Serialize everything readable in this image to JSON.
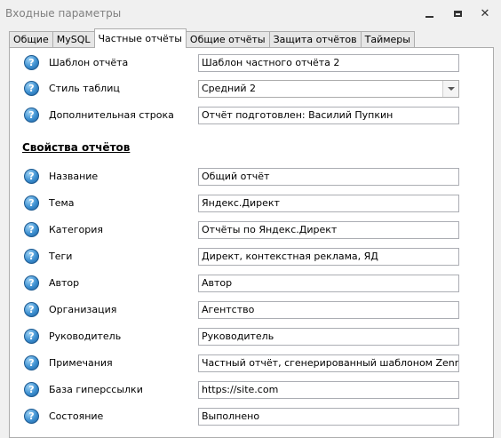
{
  "window": {
    "title": "Входные параметры",
    "controls": {
      "minimize": "minimize-icon",
      "maximize": "restore-icon",
      "close": "close-icon"
    }
  },
  "tabs": [
    {
      "label": "Общие",
      "active": false
    },
    {
      "label": "MySQL",
      "active": false
    },
    {
      "label": "Частные отчёты",
      "active": true
    },
    {
      "label": "Общие отчёты",
      "active": false
    },
    {
      "label": "Защита отчётов",
      "active": false
    },
    {
      "label": "Таймеры",
      "active": false
    }
  ],
  "report_settings": [
    {
      "label": "Шаблон отчёта",
      "value": "Шаблон частного отчёта 2",
      "type": "text"
    },
    {
      "label": "Стиль таблиц",
      "value": "Средний 2",
      "type": "select"
    },
    {
      "label": "Дополнительная строка",
      "value": "Отчёт подготовлен: Василий Пупкин",
      "type": "text"
    }
  ],
  "section_title": "Свойства отчётов",
  "properties": [
    {
      "label": "Название",
      "value": "Общий отчёт"
    },
    {
      "label": "Тема",
      "value": "Яндекс.Директ"
    },
    {
      "label": "Категория",
      "value": "Отчёты по Яндекс.Директ"
    },
    {
      "label": "Теги",
      "value": "Директ, контекстная реклама, ЯД"
    },
    {
      "label": "Автор",
      "value": "Автор"
    },
    {
      "label": "Организация",
      "value": "Агентство"
    },
    {
      "label": "Руководитель",
      "value": "Руководитель"
    },
    {
      "label": "Примечания",
      "value": "Частный отчёт, сгенерированный шаблоном ZennoPoster"
    },
    {
      "label": "База гиперссылки",
      "value": "https://site.com"
    },
    {
      "label": "Состояние",
      "value": "Выполнено"
    }
  ],
  "help_icon_glyph": "?"
}
